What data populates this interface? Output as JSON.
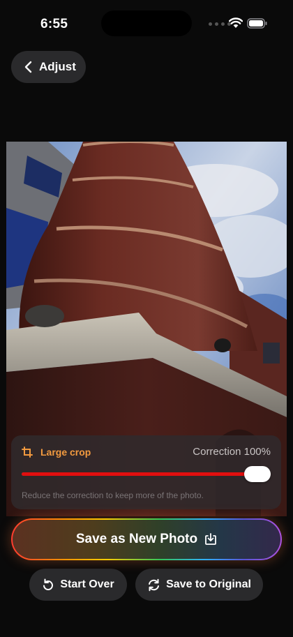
{
  "status_bar": {
    "time": "6:55",
    "icons": [
      "wifi-icon",
      "battery-icon"
    ]
  },
  "nav": {
    "back_label": "Adjust",
    "back_icon": "chevron-left-icon"
  },
  "crop_panel": {
    "mode_label": "Large crop",
    "mode_color": "#f29a3f",
    "correction_text": "Correction 100%",
    "correction_value": 1.0,
    "accent": "#e10f0f",
    "hint": "Reduce the correction to keep more of the photo."
  },
  "actions": {
    "save_new_label": "Save as New Photo",
    "start_over_label": "Start Over",
    "save_original_label": "Save to Original"
  }
}
